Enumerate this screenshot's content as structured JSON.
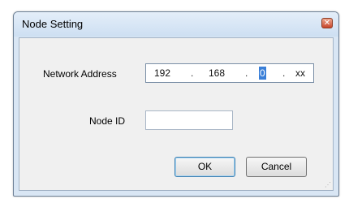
{
  "window": {
    "title": "Node Setting"
  },
  "form": {
    "network_address_label": "Network Address",
    "ip_octets": [
      "192",
      "168",
      "0",
      "xx"
    ],
    "ip_separators": [
      ".",
      ".",
      "."
    ],
    "node_id_label": "Node ID",
    "node_id_value": ""
  },
  "buttons": {
    "ok": "OK",
    "cancel": "Cancel"
  },
  "icons": {
    "close": "close-icon",
    "grip": "resize-grip-icon"
  },
  "colors": {
    "close_button": "#d0533a",
    "selection": "#3a7fd8",
    "default_button_border": "#3c7fb1"
  }
}
